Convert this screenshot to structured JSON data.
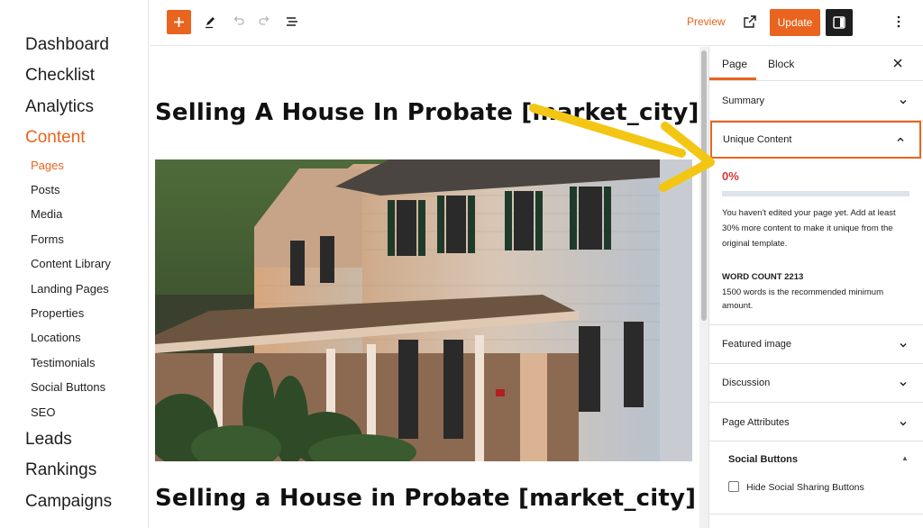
{
  "nav": {
    "main_top": [
      "Dashboard",
      "Checklist",
      "Analytics",
      "Content"
    ],
    "sub": [
      "Pages",
      "Posts",
      "Media",
      "Forms",
      "Content Library",
      "Landing Pages",
      "Properties",
      "Locations",
      "Testimonials",
      "Social Buttons",
      "SEO"
    ],
    "main_bottom": [
      "Leads",
      "Rankings",
      "Campaigns"
    ],
    "active_main": "Content",
    "active_sub": "Pages"
  },
  "toolbar": {
    "preview_label": "Preview",
    "update_label": "Update"
  },
  "editor": {
    "heading_1": "Selling A House In Probate [market_city]",
    "heading_2": "Selling a House in Probate [market_city]"
  },
  "sidebar": {
    "tabs": [
      "Page",
      "Block"
    ],
    "panels": {
      "summary": "Summary",
      "unique_content": "Unique Content",
      "featured_image": "Featured image",
      "discussion": "Discussion",
      "page_attributes": "Page Attributes"
    },
    "unique": {
      "percent": "0%",
      "progress_fraction": 0,
      "message": "You haven't edited your page yet. Add at least 30% more content to make it unique from the original template.",
      "word_count_title": "WORD COUNT 2213",
      "word_count_note": "1500 words is the recommended minimum amount."
    },
    "social": {
      "title": "Social Buttons",
      "checkbox_label": "Hide Social Sharing Buttons"
    }
  },
  "colors": {
    "accent": "#e8641f",
    "error": "#d63638",
    "arrow": "#f3c614"
  }
}
